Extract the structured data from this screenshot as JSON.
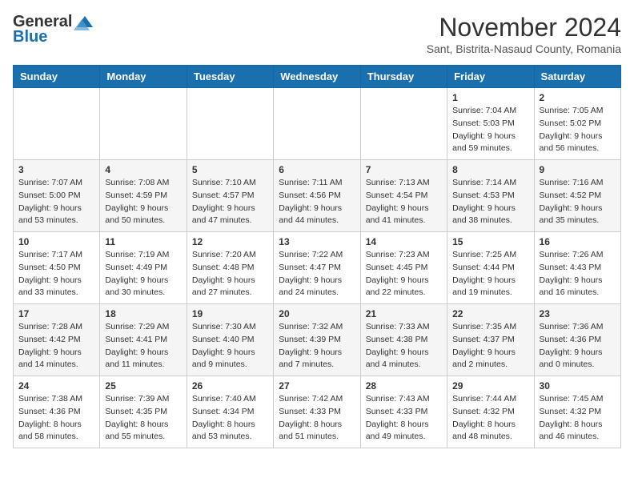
{
  "logo": {
    "line1": "General",
    "line2": "Blue"
  },
  "title": "November 2024",
  "location": "Sant, Bistrita-Nasaud County, Romania",
  "weekdays": [
    "Sunday",
    "Monday",
    "Tuesday",
    "Wednesday",
    "Thursday",
    "Friday",
    "Saturday"
  ],
  "weeks": [
    [
      {
        "day": "",
        "info": ""
      },
      {
        "day": "",
        "info": ""
      },
      {
        "day": "",
        "info": ""
      },
      {
        "day": "",
        "info": ""
      },
      {
        "day": "",
        "info": ""
      },
      {
        "day": "1",
        "info": "Sunrise: 7:04 AM\nSunset: 5:03 PM\nDaylight: 9 hours and 59 minutes."
      },
      {
        "day": "2",
        "info": "Sunrise: 7:05 AM\nSunset: 5:02 PM\nDaylight: 9 hours and 56 minutes."
      }
    ],
    [
      {
        "day": "3",
        "info": "Sunrise: 7:07 AM\nSunset: 5:00 PM\nDaylight: 9 hours and 53 minutes."
      },
      {
        "day": "4",
        "info": "Sunrise: 7:08 AM\nSunset: 4:59 PM\nDaylight: 9 hours and 50 minutes."
      },
      {
        "day": "5",
        "info": "Sunrise: 7:10 AM\nSunset: 4:57 PM\nDaylight: 9 hours and 47 minutes."
      },
      {
        "day": "6",
        "info": "Sunrise: 7:11 AM\nSunset: 4:56 PM\nDaylight: 9 hours and 44 minutes."
      },
      {
        "day": "7",
        "info": "Sunrise: 7:13 AM\nSunset: 4:54 PM\nDaylight: 9 hours and 41 minutes."
      },
      {
        "day": "8",
        "info": "Sunrise: 7:14 AM\nSunset: 4:53 PM\nDaylight: 9 hours and 38 minutes."
      },
      {
        "day": "9",
        "info": "Sunrise: 7:16 AM\nSunset: 4:52 PM\nDaylight: 9 hours and 35 minutes."
      }
    ],
    [
      {
        "day": "10",
        "info": "Sunrise: 7:17 AM\nSunset: 4:50 PM\nDaylight: 9 hours and 33 minutes."
      },
      {
        "day": "11",
        "info": "Sunrise: 7:19 AM\nSunset: 4:49 PM\nDaylight: 9 hours and 30 minutes."
      },
      {
        "day": "12",
        "info": "Sunrise: 7:20 AM\nSunset: 4:48 PM\nDaylight: 9 hours and 27 minutes."
      },
      {
        "day": "13",
        "info": "Sunrise: 7:22 AM\nSunset: 4:47 PM\nDaylight: 9 hours and 24 minutes."
      },
      {
        "day": "14",
        "info": "Sunrise: 7:23 AM\nSunset: 4:45 PM\nDaylight: 9 hours and 22 minutes."
      },
      {
        "day": "15",
        "info": "Sunrise: 7:25 AM\nSunset: 4:44 PM\nDaylight: 9 hours and 19 minutes."
      },
      {
        "day": "16",
        "info": "Sunrise: 7:26 AM\nSunset: 4:43 PM\nDaylight: 9 hours and 16 minutes."
      }
    ],
    [
      {
        "day": "17",
        "info": "Sunrise: 7:28 AM\nSunset: 4:42 PM\nDaylight: 9 hours and 14 minutes."
      },
      {
        "day": "18",
        "info": "Sunrise: 7:29 AM\nSunset: 4:41 PM\nDaylight: 9 hours and 11 minutes."
      },
      {
        "day": "19",
        "info": "Sunrise: 7:30 AM\nSunset: 4:40 PM\nDaylight: 9 hours and 9 minutes."
      },
      {
        "day": "20",
        "info": "Sunrise: 7:32 AM\nSunset: 4:39 PM\nDaylight: 9 hours and 7 minutes."
      },
      {
        "day": "21",
        "info": "Sunrise: 7:33 AM\nSunset: 4:38 PM\nDaylight: 9 hours and 4 minutes."
      },
      {
        "day": "22",
        "info": "Sunrise: 7:35 AM\nSunset: 4:37 PM\nDaylight: 9 hours and 2 minutes."
      },
      {
        "day": "23",
        "info": "Sunrise: 7:36 AM\nSunset: 4:36 PM\nDaylight: 9 hours and 0 minutes."
      }
    ],
    [
      {
        "day": "24",
        "info": "Sunrise: 7:38 AM\nSunset: 4:36 PM\nDaylight: 8 hours and 58 minutes."
      },
      {
        "day": "25",
        "info": "Sunrise: 7:39 AM\nSunset: 4:35 PM\nDaylight: 8 hours and 55 minutes."
      },
      {
        "day": "26",
        "info": "Sunrise: 7:40 AM\nSunset: 4:34 PM\nDaylight: 8 hours and 53 minutes."
      },
      {
        "day": "27",
        "info": "Sunrise: 7:42 AM\nSunset: 4:33 PM\nDaylight: 8 hours and 51 minutes."
      },
      {
        "day": "28",
        "info": "Sunrise: 7:43 AM\nSunset: 4:33 PM\nDaylight: 8 hours and 49 minutes."
      },
      {
        "day": "29",
        "info": "Sunrise: 7:44 AM\nSunset: 4:32 PM\nDaylight: 8 hours and 48 minutes."
      },
      {
        "day": "30",
        "info": "Sunrise: 7:45 AM\nSunset: 4:32 PM\nDaylight: 8 hours and 46 minutes."
      }
    ]
  ]
}
